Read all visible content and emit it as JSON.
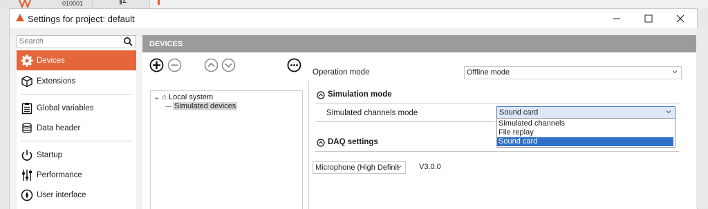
{
  "background_app": {
    "label": "010001",
    "icon_text": "∥Σ"
  },
  "window": {
    "title": "Settings for project: default"
  },
  "sidebar": {
    "search_placeholder": "Search",
    "items": [
      {
        "label": "Devices",
        "icon": "gear-icon",
        "active": true
      },
      {
        "label": "Extensions",
        "icon": "cube-icon"
      },
      {
        "label": "Global variables",
        "icon": "clipboard-icon"
      },
      {
        "label": "Data header",
        "icon": "database-icon"
      },
      {
        "label": "Startup",
        "icon": "power-icon"
      },
      {
        "label": "Performance",
        "icon": "sliders-icon"
      },
      {
        "label": "User interface",
        "icon": "compass-icon"
      }
    ]
  },
  "panel": {
    "header": "DEVICES",
    "operation_mode": {
      "label": "Operation mode",
      "value": "Offline mode"
    },
    "tree": {
      "root": "Local system",
      "child": "Simulated devices"
    },
    "simulation": {
      "title": "Simulation mode",
      "channels_label": "Simulated channels mode",
      "channels_value": "Sound card",
      "options": [
        "Simulated channels",
        "File replay",
        "Sound card"
      ]
    },
    "daq": {
      "title": "DAQ settings",
      "device_value": "Microphone (High Definit",
      "version": "V3.0.0"
    }
  },
  "colors": {
    "accent": "#e4663a",
    "header_gray": "#9b9b9b",
    "selection": "#2f70c8"
  }
}
